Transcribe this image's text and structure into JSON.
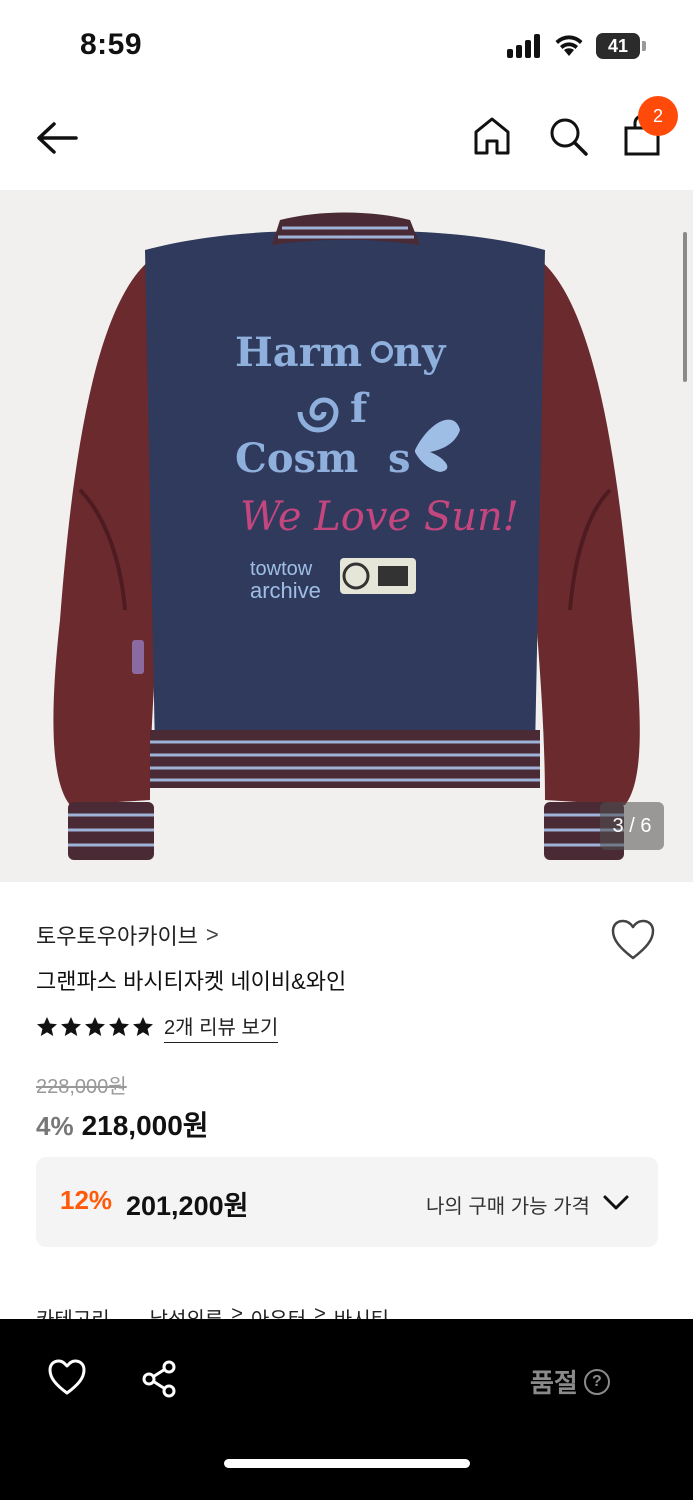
{
  "status_bar": {
    "time": "8:59",
    "battery": "41"
  },
  "navbar": {
    "cart_count": "2"
  },
  "image": {
    "counter": "3 / 6",
    "print_line1": "Harm",
    "print_line1b": "ny",
    "print_line2": "f",
    "print_line3": "Cosm",
    "print_line3b": "s",
    "print_script": "We Love Sun!",
    "print_brand1": "towtow",
    "print_brand2": "archive"
  },
  "product": {
    "brand": "토우토우아카이브",
    "brand_chevron": ">",
    "name": "그랜파스 바시티자켓 네이비&와인",
    "rating_stars": 5,
    "review_link": "2개 리뷰 보기",
    "original_price": "228,000원",
    "discount_percent": "4%",
    "sale_price": "218,000원"
  },
  "my_price": {
    "percent": "12%",
    "price": "201,200원",
    "label": "나의 구매 가능 가격"
  },
  "category": {
    "label": "카테고리",
    "path": [
      "남성의류",
      ">",
      "아우터",
      ">",
      "바시티"
    ]
  },
  "bottom_bar": {
    "status": "품절",
    "help": "?"
  },
  "colors": {
    "accent": "#ff5a0a",
    "badge": "#ff4a0a",
    "jacket_body": "#2f3a5c",
    "jacket_sleeve": "#6d2a2e"
  },
  "icons": [
    "back-arrow-icon",
    "home-icon",
    "search-icon",
    "shopping-bag-icon",
    "heart-icon",
    "star-icon",
    "chevron-down-icon",
    "share-icon",
    "help-icon"
  ]
}
